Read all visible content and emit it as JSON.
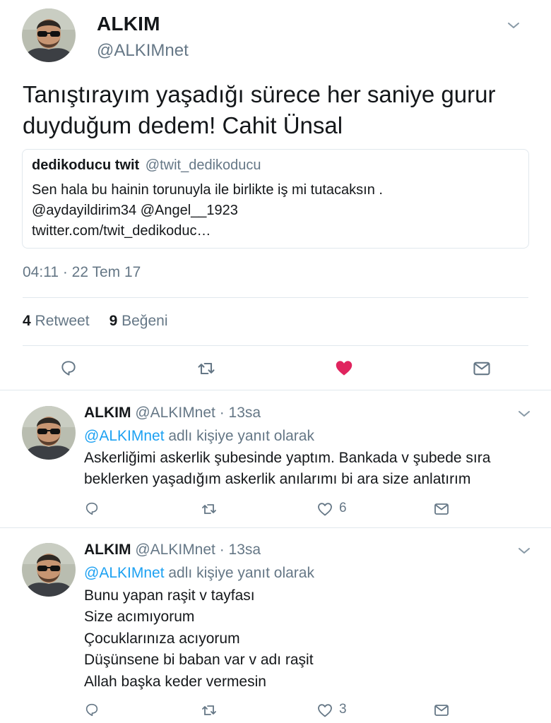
{
  "main_tweet": {
    "name": "ALKIM",
    "handle": "@ALKIMnet",
    "text": "Tanıştırayım yaşadığı sürece her saniye gurur duyduğum dedem! Cahit Ünsal",
    "quote": {
      "name": "dedikoducu twit",
      "handle": "@twit_dedikoducu",
      "lines": [
        "Sen hala bu hainin torunuyla ile birlikte iş mi tutacaksın .",
        "@aydayildirim34 @Angel__1923",
        "twitter.com/twit_dedikoduc…"
      ]
    },
    "timestamp": "04:11 · 22 Tem 17",
    "retweet_count": "4",
    "retweet_label": "Retweet",
    "like_count": "9",
    "like_label": "Beğeni",
    "actions": [
      "reply-icon",
      "retweet-icon",
      "heart-filled-icon",
      "message-icon"
    ]
  },
  "replies": [
    {
      "name": "ALKIM",
      "handle_time": "@ALKIMnet · 13sa",
      "reply_to": "@ALKIMnet",
      "reply_suffix": "adlı kişiye yanıt olarak",
      "lines": [
        "Askerliğimi askerlik şubesinde yaptım. Bankada v şubede sıra",
        "beklerken yaşadığım askerlik anılarımı bi ara size anlatırım"
      ],
      "like_count": "6"
    },
    {
      "name": "ALKIM",
      "handle_time": "@ALKIMnet · 13sa",
      "reply_to": "@ALKIMnet",
      "reply_suffix": "adlı kişiye yanıt olarak",
      "lines": [
        "Bunu yapan raşit v tayfası",
        "Size acımıyorum",
        "Çocuklarınıza acıyorum",
        "Düşünsene bi baban var v adı raşit",
        "Allah başka keder vermesin"
      ],
      "like_count": "3"
    }
  ],
  "colors": {
    "text": "#14171a",
    "secondary": "#657786",
    "link": "#1da1f2",
    "like": "#e0245e",
    "divider": "#e1e8ed"
  }
}
